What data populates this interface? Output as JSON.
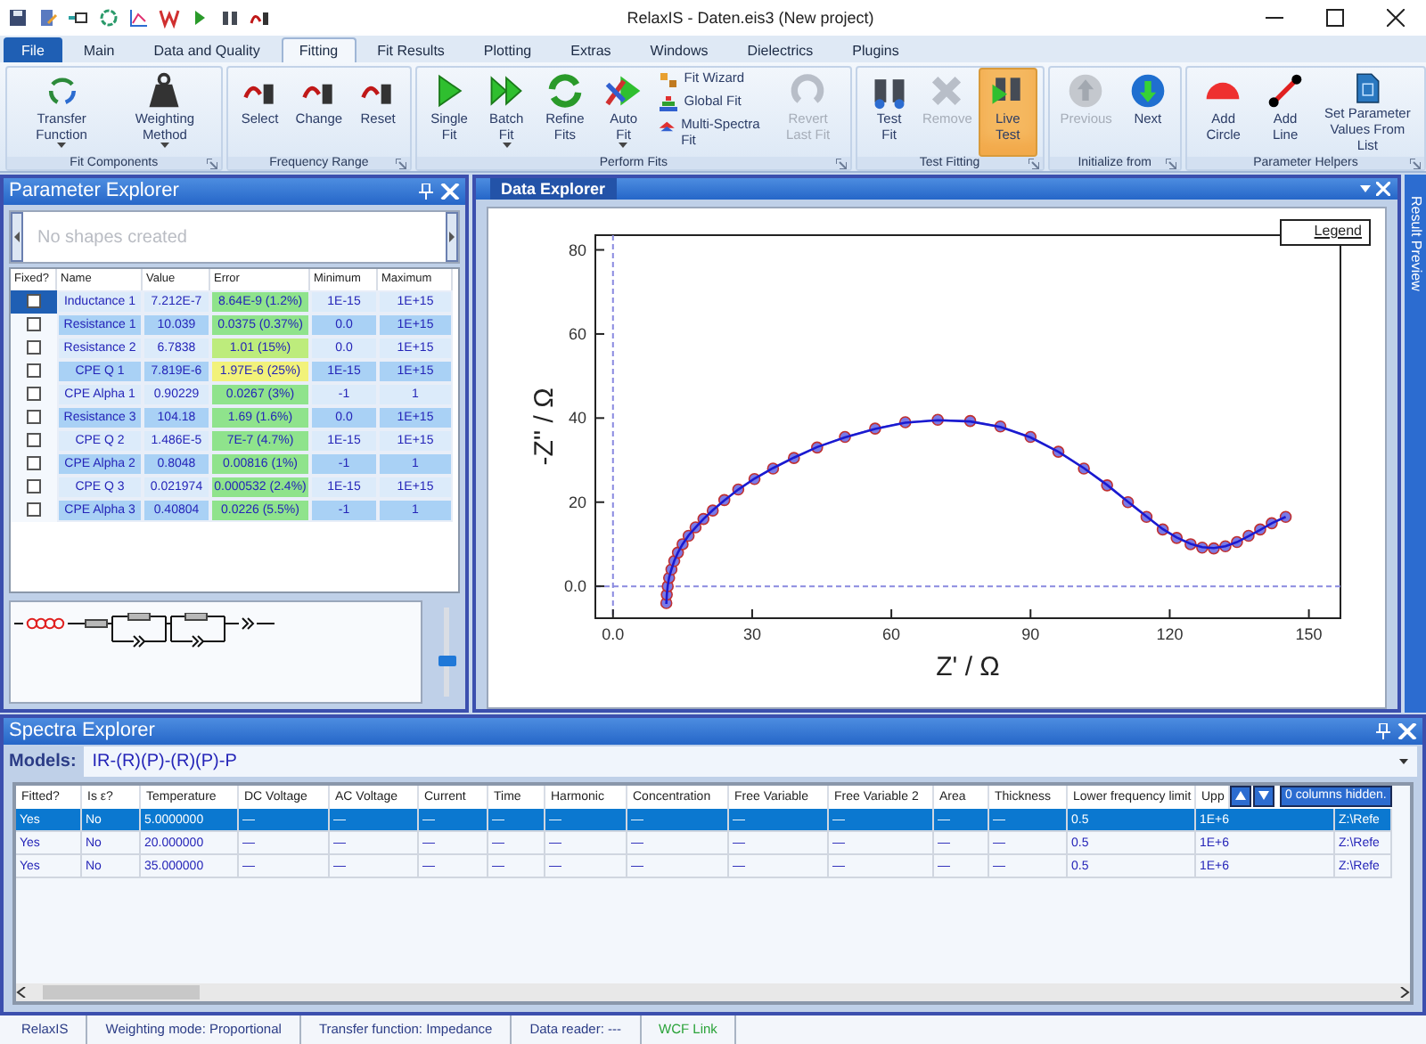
{
  "window": {
    "title": "RelaxIS - Daten.eis3 (New project)"
  },
  "tabs": [
    {
      "label": "File",
      "kind": "file",
      "selected": false
    },
    {
      "label": "Main",
      "kind": "tab",
      "selected": false
    },
    {
      "label": "Data and Quality",
      "kind": "tab",
      "selected": false
    },
    {
      "label": "Fitting",
      "kind": "tab",
      "selected": true
    },
    {
      "label": "Fit Results",
      "kind": "tab",
      "selected": false
    },
    {
      "label": "Plotting",
      "kind": "tab",
      "selected": false
    },
    {
      "label": "Extras",
      "kind": "tab",
      "selected": false
    },
    {
      "label": "Windows",
      "kind": "tab",
      "selected": false
    },
    {
      "label": "Dielectrics",
      "kind": "tab",
      "selected": false
    },
    {
      "label": "Plugins",
      "kind": "tab",
      "selected": false
    }
  ],
  "ribbon": {
    "groups": [
      {
        "label": "Fit Components",
        "buttons": [
          {
            "label": "Transfer Function",
            "kind": "large",
            "dropdown": true,
            "disabled": false,
            "on": false
          },
          {
            "label": "Weighting Method",
            "kind": "large",
            "dropdown": true,
            "disabled": false,
            "on": false
          }
        ]
      },
      {
        "label": "Frequency Range",
        "buttons": [
          {
            "label": "Select",
            "kind": "large",
            "dropdown": false,
            "disabled": false,
            "on": false
          },
          {
            "label": "Change",
            "kind": "large",
            "dropdown": false,
            "disabled": false,
            "on": false
          },
          {
            "label": "Reset",
            "kind": "large",
            "dropdown": false,
            "disabled": false,
            "on": false
          }
        ]
      },
      {
        "label": "Perform Fits",
        "buttons": [
          {
            "label": "Single Fit",
            "kind": "large",
            "dropdown": false,
            "disabled": false,
            "on": false
          },
          {
            "label": "Batch Fit",
            "kind": "large",
            "dropdown": true,
            "disabled": false,
            "on": false
          },
          {
            "label": "Refine Fits",
            "kind": "large",
            "dropdown": false,
            "disabled": false,
            "on": false
          },
          {
            "label": "Auto Fit",
            "kind": "large",
            "dropdown": true,
            "disabled": false,
            "on": false
          },
          {
            "label": "Fit Wizard",
            "kind": "small",
            "disabled": false
          },
          {
            "label": "Global Fit",
            "kind": "small",
            "disabled": false
          },
          {
            "label": "Multi-Spectra Fit",
            "kind": "small",
            "disabled": false
          },
          {
            "label": "Revert Last Fit",
            "kind": "large",
            "dropdown": false,
            "disabled": true,
            "on": false
          }
        ]
      },
      {
        "label": "Test Fitting",
        "buttons": [
          {
            "label": "Test Fit",
            "kind": "large",
            "dropdown": false,
            "disabled": false,
            "on": false
          },
          {
            "label": "Remove",
            "kind": "large",
            "dropdown": false,
            "disabled": true,
            "on": false
          },
          {
            "label": "Live Test",
            "kind": "large",
            "dropdown": false,
            "disabled": false,
            "on": true
          }
        ]
      },
      {
        "label": "Initialize from",
        "buttons": [
          {
            "label": "Previous",
            "kind": "large",
            "dropdown": false,
            "disabled": true,
            "on": false
          },
          {
            "label": "Next",
            "kind": "large",
            "dropdown": false,
            "disabled": false,
            "on": false
          }
        ]
      },
      {
        "label": "Parameter Helpers",
        "buttons": [
          {
            "label": "Add Circle",
            "kind": "large",
            "dropdown": false,
            "disabled": false,
            "on": false
          },
          {
            "label": "Add Line",
            "kind": "large",
            "dropdown": false,
            "disabled": false,
            "on": false
          },
          {
            "label": "Set Parameter Values From List",
            "kind": "large",
            "dropdown": false,
            "disabled": false,
            "on": false
          }
        ]
      }
    ]
  },
  "parameter_explorer": {
    "title": "Parameter Explorer",
    "shapes_placeholder": "No shapes created",
    "columns": [
      "Fixed?",
      "Name",
      "Value",
      "Error",
      "Minimum",
      "Maximum"
    ],
    "rows": [
      {
        "fixed": false,
        "selected": true,
        "name": "Inductance 1",
        "value": "7.212E-7",
        "error": "8.64E-9 (1.2%)",
        "color": "#8fe38c",
        "minimum": "1E-15",
        "maximum": "1E+15"
      },
      {
        "fixed": false,
        "selected": false,
        "name": "Resistance 1",
        "value": "10.039",
        "error": "0.0375 (0.37%)",
        "color": "#8fe38c",
        "minimum": "0.0",
        "maximum": "1E+15"
      },
      {
        "fixed": false,
        "selected": false,
        "name": "Resistance 2",
        "value": "6.7838",
        "error": "1.01 (15%)",
        "color": "#bdec7c",
        "minimum": "0.0",
        "maximum": "1E+15"
      },
      {
        "fixed": false,
        "selected": false,
        "name": "CPE Q 1",
        "value": "7.819E-6",
        "error": "1.97E-6 (25%)",
        "color": "#f2f27a",
        "minimum": "1E-15",
        "maximum": "1E+15"
      },
      {
        "fixed": false,
        "selected": false,
        "name": "CPE Alpha 1",
        "value": "0.90229",
        "error": "0.0267 (3%)",
        "color": "#8fe38c",
        "minimum": "-1",
        "maximum": "1"
      },
      {
        "fixed": false,
        "selected": false,
        "name": "Resistance 3",
        "value": "104.18",
        "error": "1.69 (1.6%)",
        "color": "#8fe38c",
        "minimum": "0.0",
        "maximum": "1E+15"
      },
      {
        "fixed": false,
        "selected": false,
        "name": "CPE Q 2",
        "value": "1.486E-5",
        "error": "7E-7 (4.7%)",
        "color": "#8fe38c",
        "minimum": "1E-15",
        "maximum": "1E+15"
      },
      {
        "fixed": false,
        "selected": false,
        "name": "CPE Alpha 2",
        "value": "0.8048",
        "error": "0.00816 (1%)",
        "color": "#8fe38c",
        "minimum": "-1",
        "maximum": "1"
      },
      {
        "fixed": false,
        "selected": false,
        "name": "CPE Q 3",
        "value": "0.021974",
        "error": "0.000532 (2.4%)",
        "color": "#8fe38c",
        "minimum": "1E-15",
        "maximum": "1E+15"
      },
      {
        "fixed": false,
        "selected": false,
        "name": "CPE Alpha 3",
        "value": "0.40804",
        "error": "0.0226 (5.5%)",
        "color": "#8fe38c",
        "minimum": "-1",
        "maximum": "1"
      }
    ],
    "slider": {
      "level": 0.4
    }
  },
  "data_explorer": {
    "title": "Data Explorer",
    "legend": "Legend",
    "chart_data": {
      "type": "line",
      "xlabel": "Z' / Ω",
      "ylabel": "-Z'' / Ω",
      "xlim": [
        -3.8,
        156.8
      ],
      "ylim": [
        -7.6,
        83.5
      ],
      "xticks": [
        {
          "value": 0,
          "label": "0.0"
        },
        30,
        60,
        90,
        120,
        150
      ],
      "yticks": [
        {
          "value": 0,
          "label": "0.0"
        },
        20,
        40,
        60,
        80
      ],
      "x": [
        11.5,
        11.6,
        11.8,
        12.1,
        12.6,
        13.2,
        14,
        15,
        16.3,
        17.8,
        19.5,
        21.5,
        24,
        27,
        30.5,
        34.5,
        39,
        44,
        50,
        56.5,
        63,
        70,
        77,
        83.5,
        90,
        96,
        101.5,
        106.5,
        111,
        115,
        118.5,
        121.5,
        124.5,
        127,
        129.5,
        132,
        134.5,
        137,
        139.5,
        142,
        145
      ],
      "series": [
        {
          "color": "#7a7ae6",
          "marker": "circle",
          "values": [
            -4,
            -2,
            0,
            2,
            4,
            6,
            8,
            10,
            12,
            14,
            16,
            18,
            20.5,
            23,
            25.5,
            28,
            30.5,
            33,
            35.5,
            37.5,
            39,
            39.6,
            39.3,
            38,
            35.5,
            32,
            28,
            24,
            20,
            16.5,
            13.5,
            11.5,
            10,
            9.2,
            9,
            9.5,
            10.5,
            12,
            13.5,
            15,
            16.5
          ]
        },
        {
          "color": "#1a1ad0",
          "values": [
            -4.2,
            -2,
            0.1,
            2.1,
            4,
            6,
            8,
            10,
            12.1,
            14,
            16,
            18.1,
            20.4,
            23,
            25.6,
            28.1,
            30.6,
            33.1,
            35.4,
            37.4,
            38.9,
            39.5,
            39.2,
            37.9,
            35.4,
            32,
            28.1,
            24.1,
            20.1,
            16.6,
            13.6,
            11.6,
            10.1,
            9.3,
            9.1,
            9.5,
            10.5,
            11.9,
            13.4,
            15,
            16.5
          ]
        }
      ]
    }
  },
  "result_preview": {
    "label": "Result Preview"
  },
  "spectra_explorer": {
    "title": "Spectra Explorer",
    "models_label": "Models:",
    "model": "IR-(R)(P)-(R)(P)-P",
    "columns": [
      "Fitted?",
      "Is ε?",
      "Temperature",
      "DC Voltage",
      "AC Voltage",
      "Current",
      "Time",
      "Harmonic",
      "Concentration",
      "Free Variable",
      "Free Variable 2",
      "Area",
      "Thickness",
      "Lower frequency limit",
      "Upp"
    ],
    "hidden_columns": "0 columns hidden.",
    "rows": [
      {
        "selected": true,
        "cells": [
          "Yes",
          "No",
          "5.0000000",
          "—",
          "—",
          "—",
          "—",
          "—",
          "—",
          "—",
          "—",
          "—",
          "—",
          "0.5",
          "1E+6",
          "Z:\\Refe"
        ]
      },
      {
        "selected": false,
        "cells": [
          "Yes",
          "No",
          "20.000000",
          "—",
          "—",
          "—",
          "—",
          "—",
          "—",
          "—",
          "—",
          "—",
          "—",
          "0.5",
          "1E+6",
          "Z:\\Refe"
        ]
      },
      {
        "selected": false,
        "cells": [
          "Yes",
          "No",
          "35.000000",
          "—",
          "—",
          "—",
          "—",
          "—",
          "—",
          "—",
          "—",
          "—",
          "—",
          "0.5",
          "1E+6",
          "Z:\\Refe"
        ]
      }
    ]
  },
  "status_bar": [
    {
      "text": "RelaxIS",
      "kind": "plain"
    },
    {
      "text": "Weighting mode: Proportional",
      "kind": "plain"
    },
    {
      "text": "Transfer function: Impedance",
      "kind": "plain"
    },
    {
      "text": "Data reader: ---",
      "kind": "plain"
    },
    {
      "text": "WCF Link",
      "kind": "link"
    }
  ]
}
